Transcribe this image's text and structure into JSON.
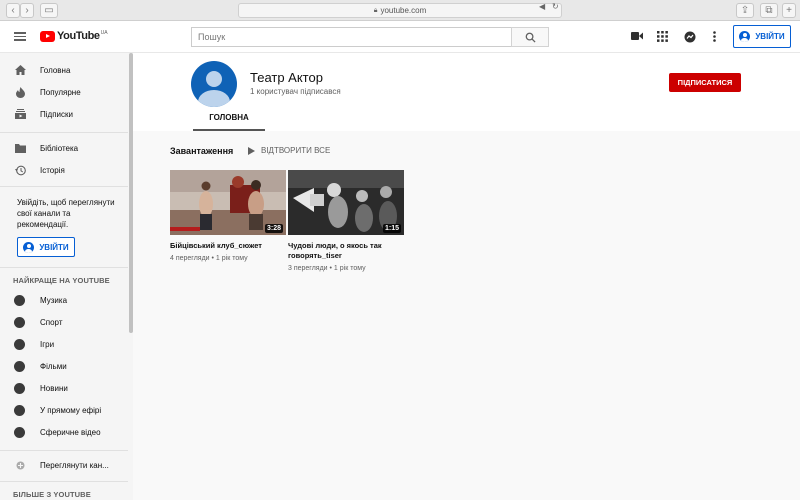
{
  "browser": {
    "url": "youtube.com"
  },
  "header": {
    "logo_text": "YouTube",
    "region": "UA",
    "search_placeholder": "Пошук",
    "signin_label": "УВІЙТИ"
  },
  "sidebar": {
    "main_items": [
      {
        "label": "Головна",
        "icon": "home-icon"
      },
      {
        "label": "Популярне",
        "icon": "flame-icon"
      },
      {
        "label": "Підписки",
        "icon": "subscriptions-icon"
      }
    ],
    "library_items": [
      {
        "label": "Бібліотека",
        "icon": "folder-icon"
      },
      {
        "label": "Історія",
        "icon": "history-icon"
      }
    ],
    "signin_note": "Увійдіть, щоб переглянути свої канали та рекомендації.",
    "signin_label": "УВІЙТИ",
    "best_heading": "НАЙКРАЩЕ НА YOUTUBE",
    "best_items": [
      {
        "label": "Музика"
      },
      {
        "label": "Спорт"
      },
      {
        "label": "Ігри"
      },
      {
        "label": "Фільми"
      },
      {
        "label": "Новини"
      },
      {
        "label": "У прямому ефірі"
      },
      {
        "label": "Сферичне відео"
      }
    ],
    "browse_channels": "Переглянути кан...",
    "more_heading": "БІЛЬШЕ З YOUTUBE"
  },
  "channel": {
    "name": "Театр Актор",
    "subscribers": "1 користувач підписався",
    "subscribe_label": "ПІДПИСАТИСЯ",
    "tab_home": "ГОЛОВНА"
  },
  "uploads": {
    "section_title": "Завантаження",
    "play_all": "ВІДТВОРИТИ ВСЕ",
    "videos": [
      {
        "title": "Бійцівський клуб_сюжет",
        "duration": "3:28",
        "meta": "4 перегляди • 1 рік тому"
      },
      {
        "title": "Чудові люди, о якось так говорять_tiser",
        "duration": "1:15",
        "meta": "3 перегляди • 1 рік тому"
      }
    ]
  },
  "colors": {
    "brand_red": "#ff0000",
    "subscribe_red": "#cc0000",
    "link_blue": "#065fd4"
  }
}
